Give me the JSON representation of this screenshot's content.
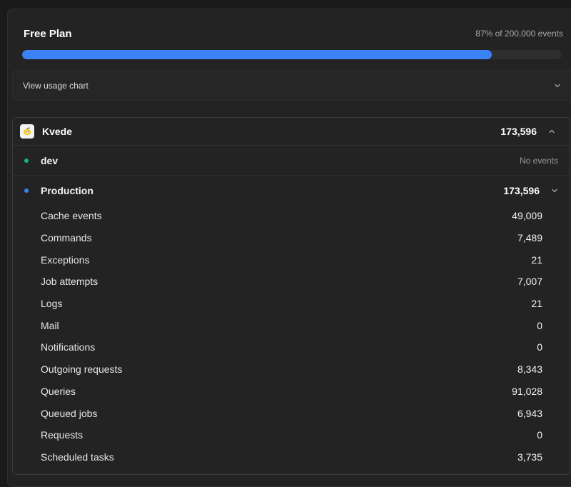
{
  "plan": {
    "title": "Free Plan",
    "usage_text": "87% of 200,000 events",
    "usage_percent": 87,
    "bar_color": "#3b82f6"
  },
  "chart_toggle": {
    "label": "View usage chart",
    "icon": "chevron-down-icon"
  },
  "project": {
    "name": "Kvede",
    "logo_icon": "lemon-logo-icon",
    "total": "173,596",
    "expand_icon": "chevron-up-icon",
    "environments": [
      {
        "name": "dev",
        "status_color": "#10b981",
        "meta": "No events"
      },
      {
        "name": "Production",
        "status_color": "#3b82f6",
        "total": "173,596",
        "expand_icon": "chevron-down-icon"
      }
    ],
    "events": [
      {
        "name": "Cache events",
        "value": "49,009"
      },
      {
        "name": "Commands",
        "value": "7,489"
      },
      {
        "name": "Exceptions",
        "value": "21"
      },
      {
        "name": "Job attempts",
        "value": "7,007"
      },
      {
        "name": "Logs",
        "value": "21"
      },
      {
        "name": "Mail",
        "value": "0"
      },
      {
        "name": "Notifications",
        "value": "0"
      },
      {
        "name": "Outgoing requests",
        "value": "8,343"
      },
      {
        "name": "Queries",
        "value": "91,028"
      },
      {
        "name": "Queued jobs",
        "value": "6,943"
      },
      {
        "name": "Requests",
        "value": "0"
      },
      {
        "name": "Scheduled tasks",
        "value": "3,735"
      }
    ]
  }
}
